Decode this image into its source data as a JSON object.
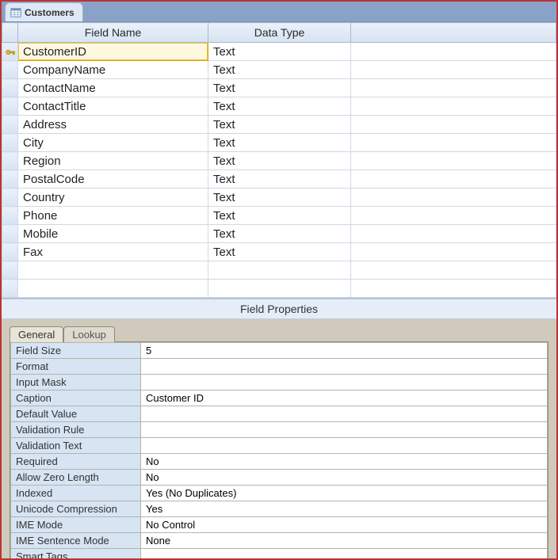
{
  "tab": {
    "title": "Customers",
    "icon": "table-icon"
  },
  "grid": {
    "headers": {
      "field_name": "Field Name",
      "data_type": "Data Type"
    },
    "rows": [
      {
        "key": true,
        "field": "CustomerID",
        "type": "Text"
      },
      {
        "key": false,
        "field": "CompanyName",
        "type": "Text"
      },
      {
        "key": false,
        "field": "ContactName",
        "type": "Text"
      },
      {
        "key": false,
        "field": "ContactTitle",
        "type": "Text"
      },
      {
        "key": false,
        "field": "Address",
        "type": "Text"
      },
      {
        "key": false,
        "field": "City",
        "type": "Text"
      },
      {
        "key": false,
        "field": "Region",
        "type": "Text"
      },
      {
        "key": false,
        "field": "PostalCode",
        "type": "Text"
      },
      {
        "key": false,
        "field": "Country",
        "type": "Text"
      },
      {
        "key": false,
        "field": "Phone",
        "type": "Text"
      },
      {
        "key": false,
        "field": "Mobile",
        "type": "Text"
      },
      {
        "key": false,
        "field": "Fax",
        "type": "Text"
      },
      {
        "key": false,
        "field": "",
        "type": ""
      },
      {
        "key": false,
        "field": "",
        "type": ""
      }
    ],
    "selected_row_index": 0
  },
  "field_properties_label": "Field Properties",
  "subtabs": {
    "general": "General",
    "lookup": "Lookup",
    "active": "general"
  },
  "properties": [
    {
      "name": "Field Size",
      "value": "5"
    },
    {
      "name": "Format",
      "value": ""
    },
    {
      "name": "Input Mask",
      "value": ""
    },
    {
      "name": "Caption",
      "value": "Customer ID"
    },
    {
      "name": "Default Value",
      "value": ""
    },
    {
      "name": "Validation Rule",
      "value": ""
    },
    {
      "name": "Validation Text",
      "value": ""
    },
    {
      "name": "Required",
      "value": "No"
    },
    {
      "name": "Allow Zero Length",
      "value": "No"
    },
    {
      "name": "Indexed",
      "value": "Yes (No Duplicates)"
    },
    {
      "name": "Unicode Compression",
      "value": "Yes"
    },
    {
      "name": "IME Mode",
      "value": "No Control"
    },
    {
      "name": "IME Sentence Mode",
      "value": "None"
    },
    {
      "name": "Smart Tags",
      "value": ""
    }
  ]
}
